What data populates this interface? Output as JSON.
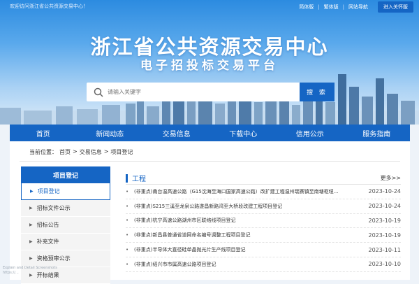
{
  "header": {
    "welcome": "欢迎访问浙江省公共资源交易中心！",
    "links": [
      "简体版",
      "繁体版",
      "网站导航"
    ],
    "elder_mode": "进入关怀版",
    "title": "浙江省公共资源交易中心",
    "subtitle": "电子招投标交易平台"
  },
  "search": {
    "placeholder": "请输入关键字",
    "button": "搜 索",
    "icon": "search-icon"
  },
  "nav": [
    "首页",
    "新闻动态",
    "交易信息",
    "下载中心",
    "信用公示",
    "服务指南"
  ],
  "breadcrumb": {
    "prefix": "当前位置：",
    "items": [
      "首页",
      "交易信息",
      "项目登记"
    ],
    "separator": ">"
  },
  "sidebar": {
    "title": "项目登记",
    "items": [
      {
        "label": "项目登记",
        "active": true
      },
      {
        "label": "招标文件公示",
        "active": false
      },
      {
        "label": "招标公告",
        "active": false
      },
      {
        "label": "补充文件",
        "active": false
      },
      {
        "label": "资格预审公示",
        "active": false
      },
      {
        "label": "开标结果",
        "active": false
      }
    ]
  },
  "list": {
    "title": "工程",
    "more": "更多>>",
    "rows": [
      {
        "text": "(非重点)甬台温高速公路（G15沈海至海口国家高速公路）改扩建工程温州瑞赛镇至南塘枢纽...",
        "date": "2023-10-24"
      },
      {
        "text": "(非重点)S215三溪至龙泉公路遂昌新路湾至大桥段改建工程项目登记",
        "date": "2023-10-24"
      },
      {
        "text": "(非重点)杭宁高速公路湖州市区联络线项目登记",
        "date": "2023-10-19"
      },
      {
        "text": "(非重点)新昌县普通省道网命名编号调整工程项目登记",
        "date": "2023-10-19"
      },
      {
        "text": "(非重点)半导体大直径硅单晶抛光片生产线项目登记",
        "date": "2023-10-11"
      },
      {
        "text": "(非重点)绍兴市市属高速公路项目登记",
        "date": "2023-10-10"
      }
    ]
  },
  "watermark": [
    "Explain and Detail Screenshots",
    "https://..."
  ],
  "colors": {
    "primary": "#1565c4",
    "sky_top": "#2c8be0"
  }
}
